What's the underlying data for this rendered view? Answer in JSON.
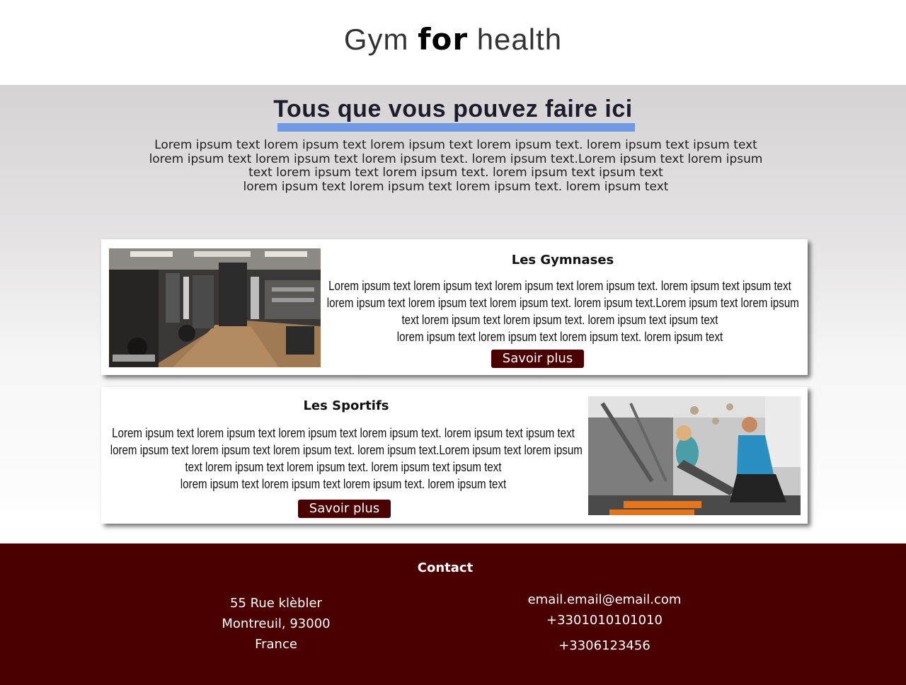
{
  "header": {
    "logo_part1": "Gym ",
    "logo_part2": "for",
    "logo_part3": " health"
  },
  "intro": {
    "title": "Tous que vous pouvez faire ici",
    "lines": [
      "Lorem ipsum text lorem ipsum text lorem ipsum text lorem ipsum text. lorem ipsum text ipsum text",
      "lorem ipsum text lorem ipsum text lorem ipsum text. lorem ipsum text.Lorem ipsum text lorem ipsum",
      "text lorem ipsum text lorem ipsum text. lorem ipsum text ipsum text",
      "lorem ipsum text lorem ipsum text lorem ipsum text. lorem ipsum text"
    ]
  },
  "cards": [
    {
      "title": "Les Gymnases",
      "image": "gym-interior-photo",
      "lines": [
        "Lorem ipsum text lorem ipsum text lorem ipsum text lorem ipsum text. lorem ipsum text ipsum text",
        "lorem ipsum text lorem ipsum text lorem ipsum text. lorem ipsum text.Lorem ipsum text lorem ipsum",
        "text lorem ipsum text lorem ipsum text. lorem ipsum text ipsum text",
        "lorem ipsum text lorem ipsum text lorem ipsum text. lorem ipsum text"
      ],
      "button": "Savoir plus"
    },
    {
      "title": "Les Sportifs",
      "image": "trainer-and-athlete-photo",
      "lines": [
        "Lorem ipsum text lorem ipsum text lorem ipsum text lorem ipsum text. lorem ipsum text ipsum text",
        "lorem ipsum text lorem ipsum text lorem ipsum text. lorem ipsum text.Lorem ipsum text lorem ipsum",
        "text lorem ipsum text lorem ipsum text. lorem ipsum text ipsum text",
        "lorem ipsum text lorem ipsum text lorem ipsum text. lorem ipsum text"
      ],
      "button": "Savoir plus"
    }
  ],
  "footer": {
    "title": "Contact",
    "address": [
      "55 Rue klèbler",
      "Montreuil, 93000",
      "France"
    ],
    "email": "email.email@email.com",
    "phone1": "+3301010101010",
    "phone2": "+3306123456"
  },
  "colors": {
    "accent_bar": "#6f9be6",
    "brand_dark": "#4a0000"
  }
}
